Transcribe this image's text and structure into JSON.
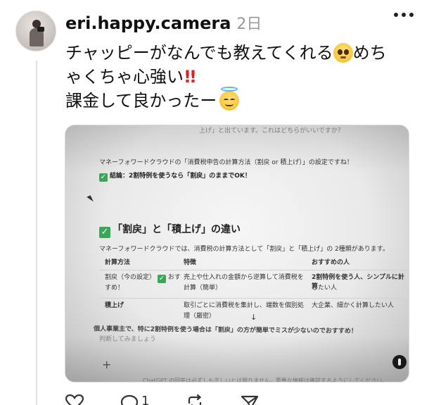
{
  "post": {
    "username": "eri.happy.camera",
    "time": "2日",
    "text_line1": "チャッピーがなんでも教えてくれる",
    "text_line1_tail": "めち",
    "text_line2": "ゃくちゃ心強い",
    "text_line2_bang": "!!",
    "text_line3": "課金して良かったー",
    "avatar_alt": "avatar"
  },
  "photo": {
    "top_fragment": "上げ」と出ています。これはどちらがいいですか？",
    "intro": "マネーフォワードクラウドの「消費税申告の計算方法（割戻 or 積上げ）」の設定ですね！",
    "conclusion": "結論：2割特例を使うなら「割戻」のままでOK！",
    "section_title": "「割戻」と「積上げ」の違い",
    "section_desc": "マネーフォワードクラウドでは、消費税の計算方法として「割戻」と「積上げ」の 2種類があります。",
    "table": {
      "headers": [
        "計算方法",
        "特徴",
        "おすすめの人"
      ],
      "rows": [
        {
          "method": "割戻（今の設定）",
          "method_tail": "おす",
          "method_tail2": "すめ！",
          "feature": "売上や仕入れの金額から逆算して消費税を",
          "feature2": "計算（簡単）",
          "who": "2割特例を使う人、シンプルに計算",
          "who2": "したい人"
        },
        {
          "method": "積上げ",
          "method_tail": "",
          "method_tail2": "",
          "feature": "取引ごとに消費税を集計し、端数を個別処",
          "feature2": "理（厳密）",
          "who": "大企業、細かく計算したい人",
          "who2": ""
        }
      ]
    },
    "bottom_fragment": "個人事業主で、特に2割特例を使う場合は「割戻」の方が簡単でミスが少ないのでおすすめ！",
    "bottom_fragment2": "判断してみましょう",
    "footer_fragment": "ChatGPT の回答は必ずしも正しいとは限りません。重要な情報は確認するようにしてください。",
    "down_arrow": "↓",
    "plus": "+"
  },
  "actions": {
    "like_icon": "heart-icon",
    "comment_icon": "comment-icon",
    "comment_count": "1",
    "repost_icon": "repost-icon",
    "share_icon": "share-icon"
  }
}
